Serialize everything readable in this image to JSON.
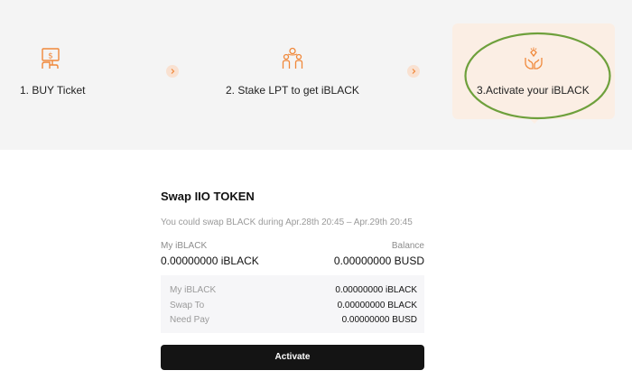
{
  "steps": [
    {
      "label": "1. BUY Ticket",
      "icon": "ticket-hand-icon"
    },
    {
      "label": "2. Stake LPT to get iBLACK",
      "icon": "staking-people-icon"
    },
    {
      "label": "3.Activate your iBLACK",
      "icon": "gem-hands-icon"
    }
  ],
  "colors": {
    "accent": "#f0883a",
    "band": "#f4f4f4",
    "active_step": "#fbeee4",
    "highlight_ring": "#6ea03c",
    "button": "#141414"
  },
  "card": {
    "title": "Swap IIO TOKEN",
    "note_prefix": "You could swap BLACK during",
    "note_period": "Apr.28th 20:45 – Apr.29th 20:45",
    "my_label": "My iBLACK",
    "balance_label": "Balance",
    "my_value": "0.00000000 iBLACK",
    "balance_value": "0.00000000 BUSD",
    "details": [
      {
        "label": "My iBLACK",
        "value": "0.00000000 iBLACK"
      },
      {
        "label": "Swap To",
        "value": "0.00000000 BLACK"
      },
      {
        "label": "Need Pay",
        "value": "0.00000000 BUSD"
      }
    ],
    "button_label": "Activate"
  }
}
